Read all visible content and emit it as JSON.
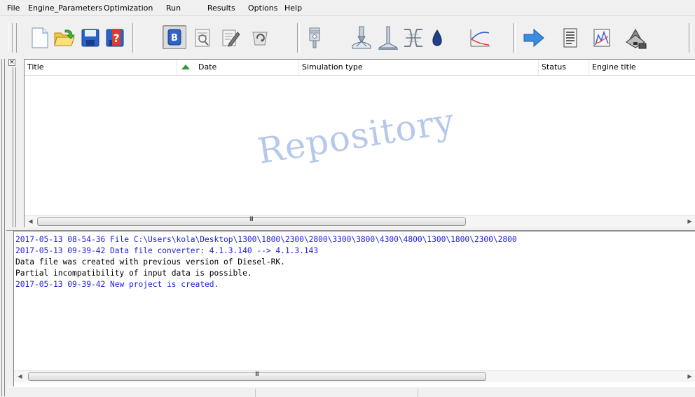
{
  "menu": [
    {
      "label": "File"
    },
    {
      "label": "Engine_Parameters"
    },
    {
      "label": "Optimization"
    },
    {
      "label": "Run"
    },
    {
      "label": "Results"
    },
    {
      "label": "Options"
    },
    {
      "label": "Help"
    }
  ],
  "toolbar": {
    "buttons": [
      {
        "icon": "new-file-icon"
      },
      {
        "icon": "open-folder-icon"
      },
      {
        "icon": "save-icon"
      },
      {
        "icon": "save-as-icon"
      },
      {
        "icon": "repository-icon",
        "pressed": true
      },
      {
        "icon": "preview-icon"
      },
      {
        "icon": "edit-icon"
      },
      {
        "icon": "refresh-icon"
      },
      {
        "icon": "piston-icon"
      },
      {
        "icon": "injector-icon"
      },
      {
        "icon": "valve-icon"
      },
      {
        "icon": "nozzle-icon"
      },
      {
        "icon": "fuel-drop-icon"
      },
      {
        "icon": "curve-icon"
      },
      {
        "icon": "run-arrow-icon"
      },
      {
        "icon": "report-icon"
      },
      {
        "icon": "chart-icon"
      },
      {
        "icon": "engine-icon"
      }
    ]
  },
  "repository": {
    "columns": [
      {
        "label": "Title"
      },
      {
        "label": "Date"
      },
      {
        "label": "Simulation type"
      },
      {
        "label": "Status"
      },
      {
        "label": "Engine title"
      }
    ],
    "watermark": "Repository",
    "close_glyph": "×"
  },
  "log": {
    "lines": [
      {
        "text": "2017-05-13 08-54-36 File C:\\Users\\kola\\Desktop\\1300\\1800\\2300\\2800\\3300\\3800\\4300\\4800\\1300\\1800\\2300\\2800",
        "color": "#2020e0"
      },
      {
        "text": "2017-05-13 09-39-42 Data file converter:  4.1.3.140 --> 4.1.3.143",
        "color": "#2020e0"
      },
      {
        "text": "Data file was created with previous version of Diesel-RK.",
        "color": "#000000"
      },
      {
        "text": "Partial incompatibility of input data is possible.",
        "color": "#000000"
      },
      {
        "text": "2017-05-13 09-39-42 New project is created.",
        "color": "#2020e0"
      }
    ]
  },
  "scroll": {
    "thumb_grip": "III",
    "left_arrow": "◀",
    "right_arrow": "▶"
  },
  "colors": {
    "log_blue": "#2020e0",
    "watermark": "#b7c9ea",
    "sort_arrow": "#2e9b2e"
  }
}
